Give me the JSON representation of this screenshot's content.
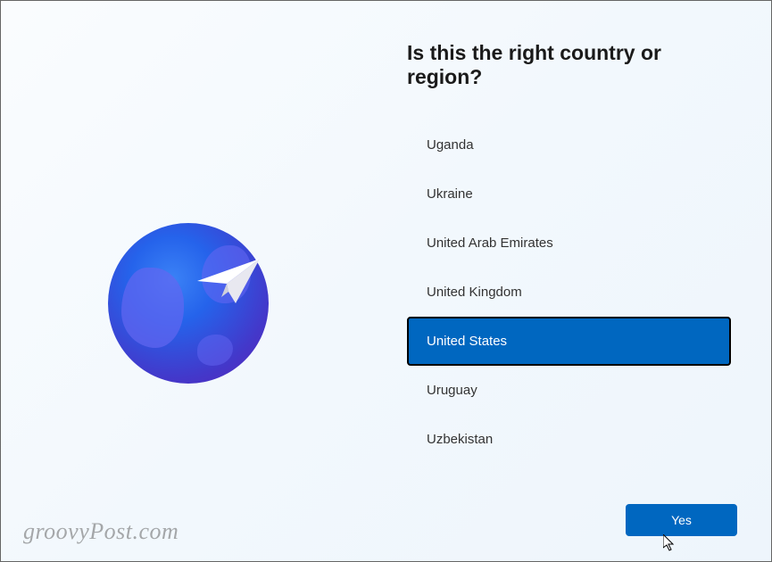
{
  "heading": "Is this the right country or region?",
  "countries": [
    {
      "name": "Uganda",
      "selected": false
    },
    {
      "name": "Ukraine",
      "selected": false
    },
    {
      "name": "United Arab Emirates",
      "selected": false
    },
    {
      "name": "United Kingdom",
      "selected": false
    },
    {
      "name": "United States",
      "selected": true
    },
    {
      "name": "Uruguay",
      "selected": false
    },
    {
      "name": "Uzbekistan",
      "selected": false
    }
  ],
  "yes_button_label": "Yes",
  "watermark": "groovyPost.com",
  "colors": {
    "accent": "#0067c0",
    "selected_bg": "#0067c0",
    "text": "#1a1a1a"
  }
}
